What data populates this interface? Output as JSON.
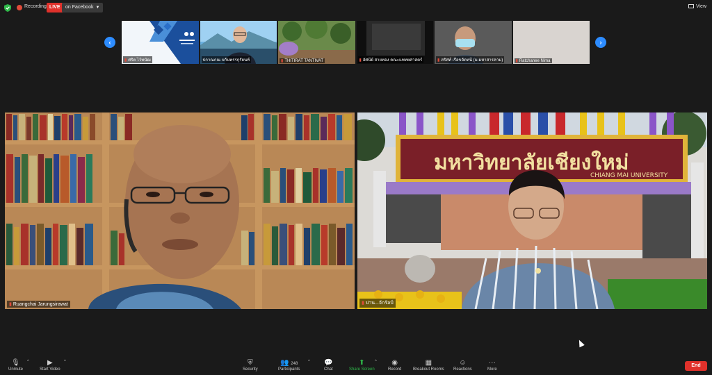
{
  "top": {
    "recording_label": "Recording",
    "live_label": "LIVE",
    "facebook_label": "on Facebook",
    "view_label": "View"
  },
  "thumbnails": [
    {
      "name": "ศริต ไว้ทนัฒ"
    },
    {
      "name": "ปกาณกณ บกันทรรกุรัยนท์"
    },
    {
      "name": "THITIRAT TANTIVAT"
    },
    {
      "name": "อัศนีย์ สายทอง คณะแพทยศาสตร์"
    },
    {
      "name": "สรัศท์ เรือขจัดหนี (ม.มหาสารคาม)"
    },
    {
      "name": "Ratchanee Nima"
    }
  ],
  "videos": {
    "left_name": "Ruangchai Jarungsirawat",
    "right_name": "ปาน...จักรัลป์",
    "sign_thai": "มหาวิทยาลัยเชียงใหม่",
    "sign_en": "CHIANG MAI UNIVERSITY"
  },
  "toolbar": {
    "unmute": "Unmute",
    "start_video": "Start Video",
    "security": "Security",
    "participants": "Participants",
    "participants_count": "248",
    "chat": "Chat",
    "share_screen": "Share Screen",
    "record": "Record",
    "breakout": "Breakout Rooms",
    "reactions": "Reactions",
    "more": "More",
    "end": "End"
  }
}
